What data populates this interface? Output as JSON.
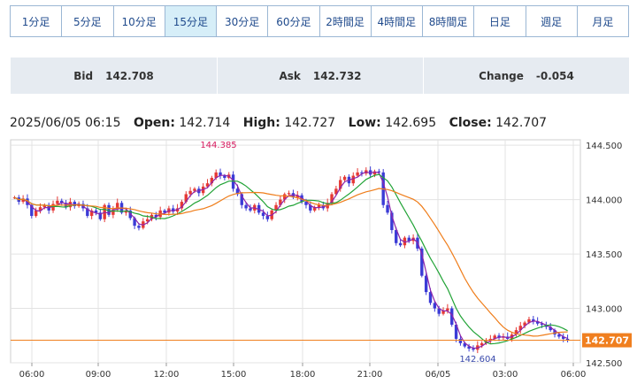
{
  "timeframes": [
    {
      "label": "1分足",
      "active": false
    },
    {
      "label": "5分足",
      "active": false
    },
    {
      "label": "10分足",
      "active": false
    },
    {
      "label": "15分足",
      "active": true
    },
    {
      "label": "30分足",
      "active": false
    },
    {
      "label": "60分足",
      "active": false
    },
    {
      "label": "2時間足",
      "active": false
    },
    {
      "label": "4時間足",
      "active": false
    },
    {
      "label": "8時間足",
      "active": false
    },
    {
      "label": "日足",
      "active": false
    },
    {
      "label": "週足",
      "active": false
    },
    {
      "label": "月足",
      "active": false
    }
  ],
  "quote": {
    "bid_label": "Bid",
    "bid": "142.708",
    "ask_label": "Ask",
    "ask": "142.732",
    "change_label": "Change",
    "change": "-0.054"
  },
  "ohlc": {
    "datetime": "2025/06/05 06:15",
    "open_label": "Open:",
    "open": "142.714",
    "high_label": "High:",
    "high": "142.727",
    "low_label": "Low:",
    "low": "142.695",
    "close_label": "Close:",
    "close": "142.707"
  },
  "chart_data": {
    "type": "candlestick",
    "y_ticks": [
      "144.500",
      "144.000",
      "143.500",
      "143.000",
      "142.500"
    ],
    "ylim": [
      142.5,
      144.55
    ],
    "x_ticks": [
      "06:00",
      "09:00",
      "12:00",
      "15:00",
      "18:00",
      "21:00",
      "06/05",
      "03:00",
      "06:00"
    ],
    "high_marker": "144.385",
    "low_marker": "142.604",
    "current_price": "142.707",
    "series": [
      {
        "legend": "purple"
      },
      {
        "legend": "green"
      },
      {
        "legend": "orange"
      }
    ],
    "colors": {
      "up": "#e53935",
      "down": "#3b3bd6",
      "ma_fast": "#8e24aa",
      "ma_mid": "#21a336",
      "ma_slow": "#ef7d1a",
      "price_line": "#f07f1f",
      "marker_high": "#d81b60",
      "marker_low": "#3949ab",
      "grid": "#e3e3e3"
    },
    "closes": [
      144.02,
      143.98,
      144.01,
      143.95,
      143.85,
      143.9,
      143.93,
      143.95,
      143.9,
      143.96,
      143.99,
      143.97,
      143.93,
      143.98,
      143.94,
      143.96,
      143.92,
      143.85,
      143.9,
      143.88,
      143.82,
      143.95,
      143.86,
      143.91,
      143.97,
      143.88,
      143.9,
      143.83,
      143.76,
      143.74,
      143.8,
      143.82,
      143.86,
      143.84,
      143.9,
      143.88,
      143.92,
      143.89,
      143.92,
      143.98,
      144.05,
      144.08,
      144.1,
      144.06,
      144.12,
      144.15,
      144.2,
      144.25,
      144.22,
      144.2,
      144.23,
      144.1,
      144.05,
      143.95,
      143.92,
      143.9,
      143.95,
      143.88,
      143.85,
      143.82,
      143.9,
      143.95,
      144.0,
      144.05,
      144.06,
      144.02,
      144.04,
      143.98,
      143.95,
      143.9,
      143.93,
      143.95,
      143.92,
      143.97,
      144.05,
      144.1,
      144.18,
      144.21,
      144.15,
      144.22,
      144.25,
      144.24,
      144.27,
      144.23,
      144.26,
      144.25,
      143.95,
      143.88,
      143.72,
      143.6,
      143.58,
      143.65,
      143.62,
      143.65,
      143.55,
      143.3,
      143.15,
      143.05,
      143.0,
      142.95,
      142.98,
      143.0,
      142.85,
      142.72,
      142.68,
      142.65,
      142.63,
      142.62,
      142.66,
      142.68,
      142.7,
      142.72,
      142.75,
      142.73,
      142.74,
      142.72,
      142.76,
      142.8,
      142.84,
      142.87,
      142.9,
      142.88,
      142.86,
      142.85,
      142.83,
      142.8,
      142.76,
      142.74,
      142.72,
      142.71
    ]
  }
}
